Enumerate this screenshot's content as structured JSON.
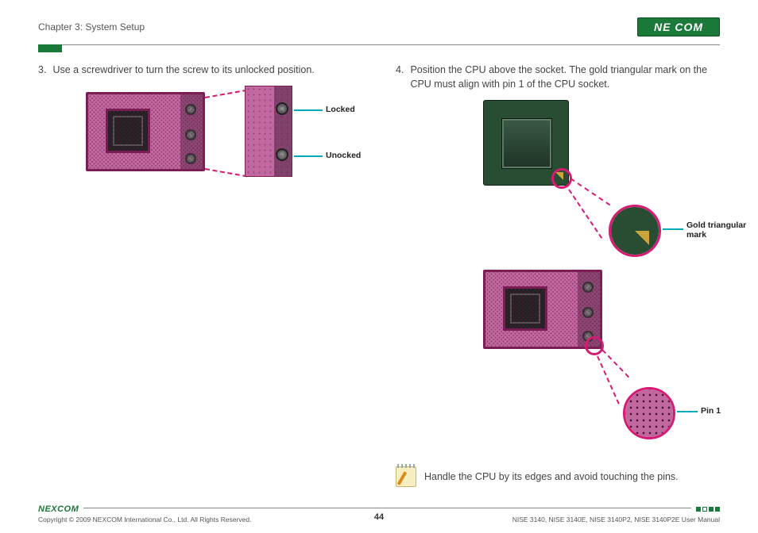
{
  "header": {
    "chapter": "Chapter 3: System Setup",
    "logo_text": "NE COM"
  },
  "steps": {
    "s3": {
      "num": "3.",
      "text": "Use a screwdriver to turn the screw to its unlocked position."
    },
    "s4": {
      "num": "4.",
      "text": "Position the CPU above the socket. The gold triangular mark on the CPU must align with pin 1 of the CPU socket."
    }
  },
  "labels": {
    "locked": "Locked",
    "unlocked": "Unocked",
    "gold_mark": "Gold triangular mark",
    "pin1": "Pin 1"
  },
  "note": {
    "text": "Handle the CPU by its edges and avoid touching the pins."
  },
  "footer": {
    "logo": "NEXCOM",
    "copyright": "Copyright © 2009 NEXCOM International Co., Ltd. All Rights Reserved.",
    "manual": "NISE 3140, NISE 3140E, NISE 3140P2, NISE 3140P2E User Manual",
    "page": "44"
  }
}
